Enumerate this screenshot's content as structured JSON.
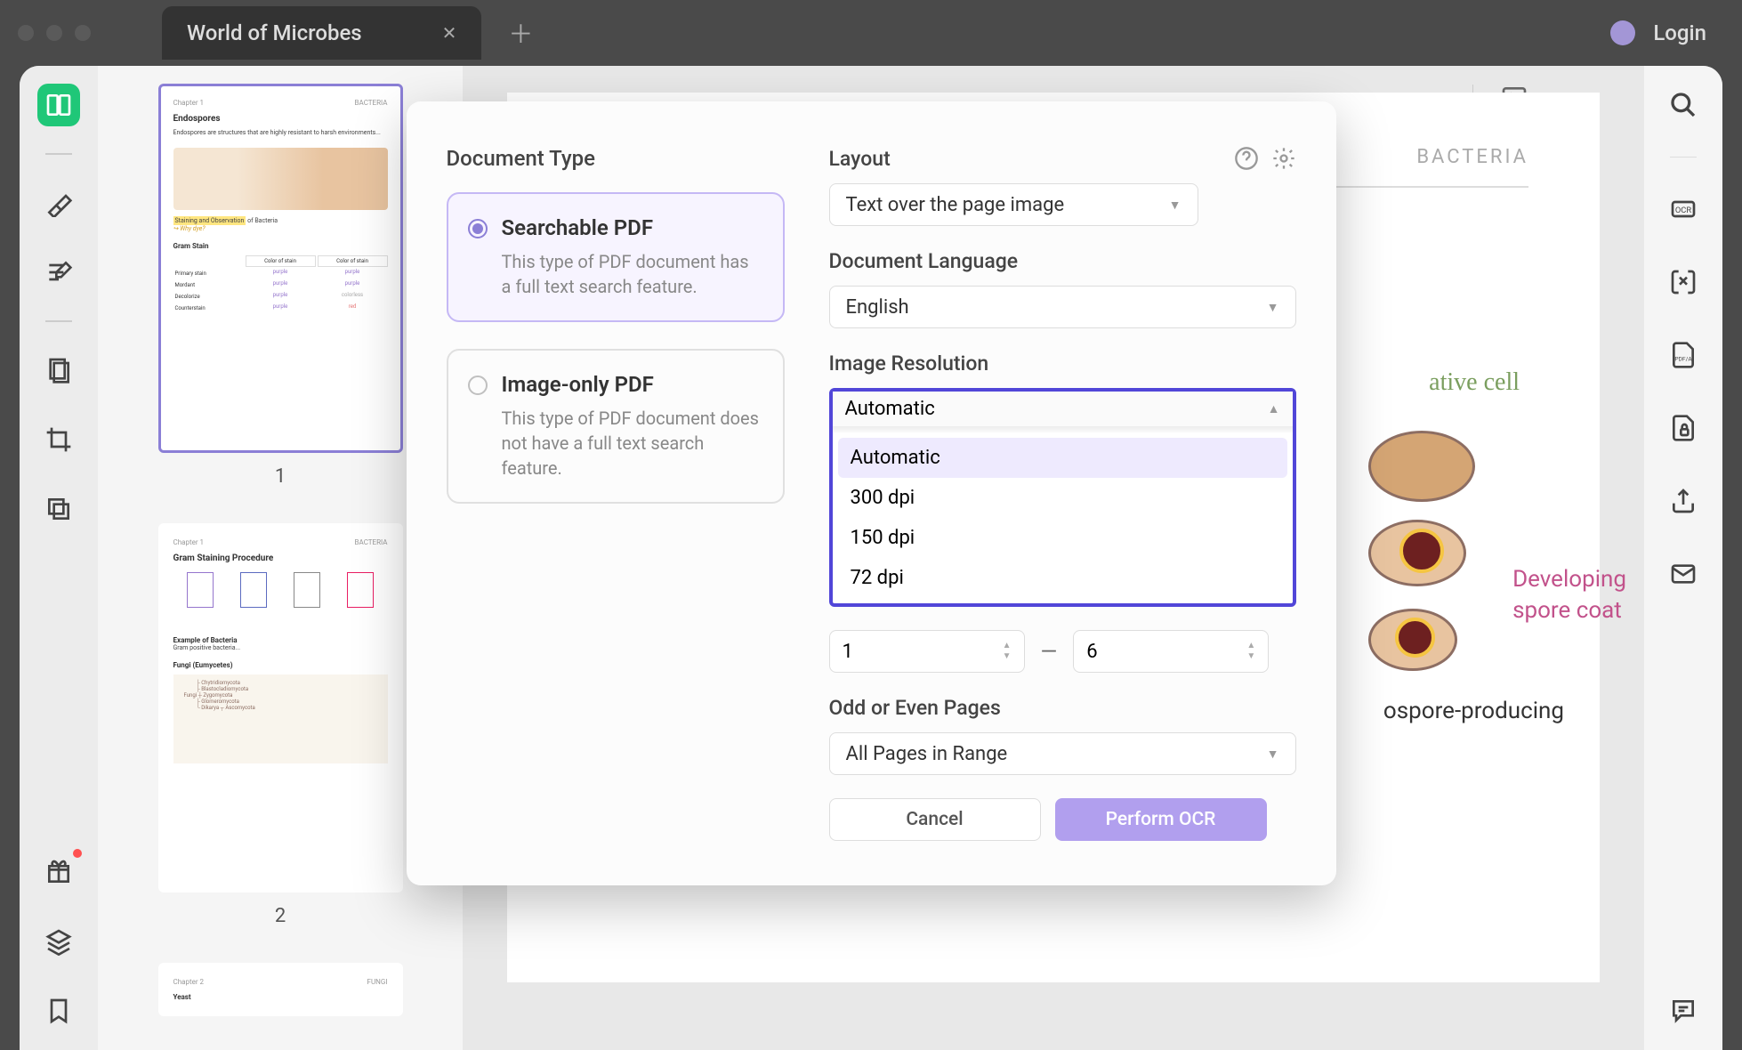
{
  "titlebar": {
    "tab_title": "World of Microbes",
    "login": "Login"
  },
  "thumbnails": [
    {
      "num": "1",
      "chapter": "Chapter 1",
      "category": "BACTERIA",
      "title": "Endospores"
    },
    {
      "num": "2",
      "chapter": "Chapter 1",
      "category": "BACTERIA",
      "title": "Gram Staining Procedure"
    }
  ],
  "document": {
    "chapter": "Chapter 1",
    "category": "BACTERIA",
    "note_ative": "ative cell",
    "note_developing": "Developing",
    "note_spore": "spore coat",
    "note_producing": "ospore-producing",
    "heading_staining": "Staining and Observation of Bacteria",
    "note_why": "Why dye?"
  },
  "modal": {
    "doc_type_label": "Document Type",
    "searchable_title": "Searchable PDF",
    "searchable_desc": "This type of PDF document has a full text search feature.",
    "image_only_title": "Image-only PDF",
    "image_only_desc": "This type of PDF document does not have a full text search feature.",
    "layout_label": "Layout",
    "layout_value": "Text over the page image",
    "lang_label": "Document Language",
    "lang_value": "English",
    "resolution_label": "Image Resolution",
    "resolution_value": "Automatic",
    "resolution_options": [
      "Automatic",
      "300 dpi",
      "150 dpi",
      "72 dpi"
    ],
    "range_from": "1",
    "range_to": "6",
    "odd_even_label": "Odd or Even Pages",
    "odd_even_value": "All Pages in Range",
    "cancel": "Cancel",
    "perform": "Perform OCR"
  }
}
